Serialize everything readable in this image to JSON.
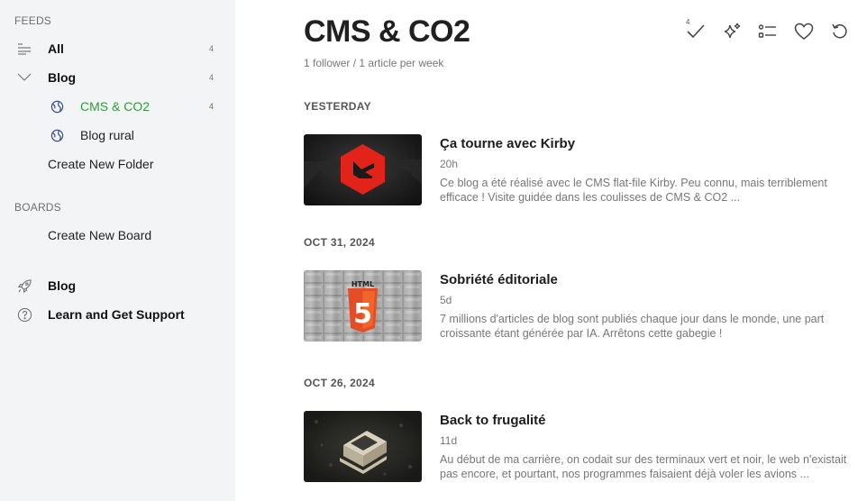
{
  "sidebar": {
    "feeds_label": "FEEDS",
    "all": {
      "label": "All",
      "count": "4"
    },
    "blog_folder": {
      "label": "Blog",
      "count": "4"
    },
    "feeds": [
      {
        "label": "CMS & CO2",
        "count": "4"
      },
      {
        "label": "Blog rural"
      }
    ],
    "create_folder": "Create New Folder",
    "boards_label": "BOARDS",
    "create_board": "Create New Board",
    "blog_link": "Blog",
    "support_link": "Learn and Get Support"
  },
  "header": {
    "title": "CMS & CO2",
    "subtitle": "1 follower / 1 article per week",
    "mark_read_count": "4"
  },
  "groups": [
    {
      "date": "YESTERDAY",
      "article": {
        "title": "Ça tourne avec Kirby",
        "age": "20h",
        "description": "Ce blog a été réalisé avec le CMS flat-file Kirby. Peu connu, mais terriblement efficace ! Visite guidée dans les coulisses de CMS & CO2 ..."
      }
    },
    {
      "date": "OCT 31, 2024",
      "article": {
        "title": "Sobriété éditoriale",
        "age": "5d",
        "description": "7 millions d'articles de blog sont publiés chaque jour dans le monde, une part croissante étant générée par IA. Arrêtons cette gabegie !",
        "thumb_text": "HTML",
        "thumb_number": "5"
      }
    },
    {
      "date": "OCT 26, 2024",
      "article": {
        "title": "Back to frugalité",
        "age": "11d",
        "description": "Au début de ma carrière, on codait sur des terminaux vert et noir, le web n'existait pas encore, et pourtant, nos programmes faisaient déjà voler les avions ..."
      }
    }
  ],
  "colors": {
    "accent": "#2f9b3a",
    "sidebar_bg": "#f3f4f6"
  }
}
